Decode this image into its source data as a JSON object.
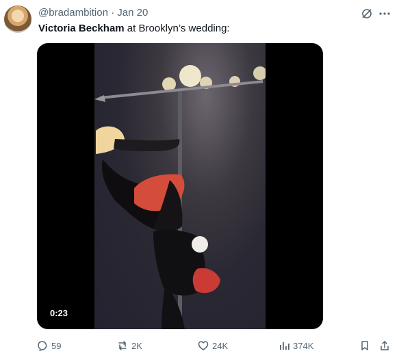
{
  "tweet": {
    "handle": "@bradambition",
    "separator": "·",
    "date": "Jan 20",
    "author_name": "Victoria Beckham",
    "text": " at Brooklyn’s wedding:"
  },
  "media": {
    "duration": "0:23"
  },
  "actions": {
    "replies": "59",
    "reposts": "2K",
    "likes": "24K",
    "views": "374K"
  },
  "icons": {
    "grok": "grok-icon",
    "more": "more-icon",
    "reply": "reply-icon",
    "repost": "repost-icon",
    "like": "like-icon",
    "views": "views-icon",
    "bookmark": "bookmark-icon",
    "share": "share-icon"
  },
  "colors": {
    "text_primary": "#0f1419",
    "text_secondary": "#536471",
    "media_bg": "#000000"
  }
}
